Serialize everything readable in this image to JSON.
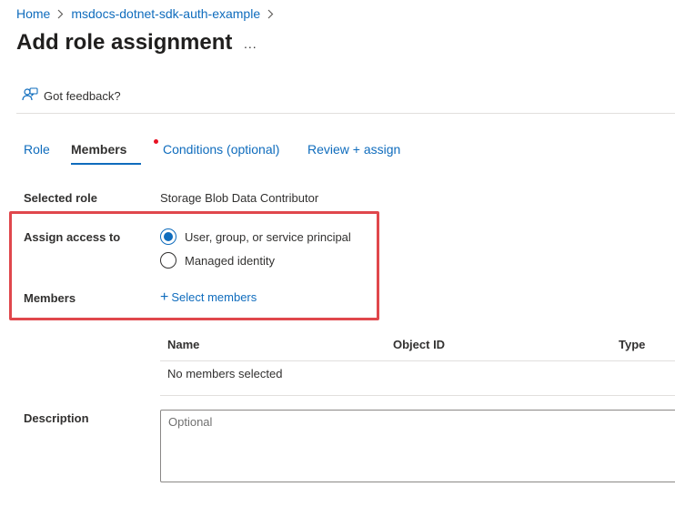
{
  "breadcrumb": {
    "items": [
      "Home",
      "msdocs-dotnet-sdk-auth-example"
    ]
  },
  "header": {
    "title": "Add role assignment",
    "more_label": "..."
  },
  "toolbar": {
    "feedback_label": "Got feedback?",
    "feedback_icon": "feedback-person-icon"
  },
  "tabs": [
    {
      "label": "Role",
      "active": false
    },
    {
      "label": "Members",
      "active": true,
      "has_indicator": true
    },
    {
      "label": "Conditions (optional)",
      "active": false
    },
    {
      "label": "Review + assign",
      "active": false
    }
  ],
  "form": {
    "selected_role_label": "Selected role",
    "selected_role_value": "Storage Blob Data Contributor",
    "assign_access_label": "Assign access to",
    "assign_options": [
      {
        "label": "User, group, or service principal",
        "selected": true
      },
      {
        "label": "Managed identity",
        "selected": false
      }
    ],
    "members_label": "Members",
    "select_members_label": "Select members",
    "description_label": "Description",
    "description_placeholder": "Optional",
    "description_value": ""
  },
  "members_table": {
    "columns": [
      "Name",
      "Object ID",
      "Type"
    ],
    "empty_text": "No members selected"
  },
  "colors": {
    "accent": "#0f6cbd",
    "highlight_border": "#e0474c",
    "tab_indicator": "#e81123"
  }
}
